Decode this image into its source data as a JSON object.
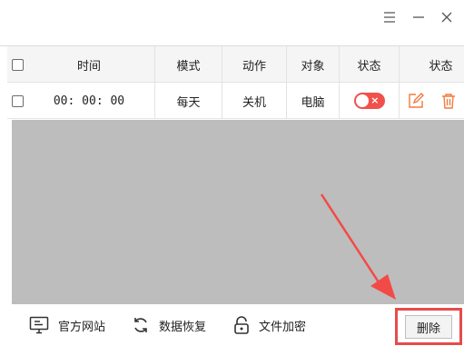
{
  "window": {
    "menu_icon": "menu-icon",
    "minimize_icon": "minimize-icon",
    "close_icon": "close-icon"
  },
  "table": {
    "columns": [
      "时间",
      "模式",
      "动作",
      "对象",
      "状态",
      "状态"
    ],
    "rows": [
      {
        "time": "00: 00: 00",
        "mode": "每天",
        "action": "关机",
        "target": "电脑",
        "status_on": false
      }
    ]
  },
  "bottom": {
    "links": [
      {
        "label": "官方网站",
        "icon": "monitor-icon"
      },
      {
        "label": "数据恢复",
        "icon": "refresh-icon"
      },
      {
        "label": "文件加密",
        "icon": "lock-icon"
      }
    ],
    "delete_label": "删除"
  },
  "colors": {
    "accent": "#f2504b",
    "action_icon": "#f07b3f",
    "highlight": "#e84a4a"
  }
}
